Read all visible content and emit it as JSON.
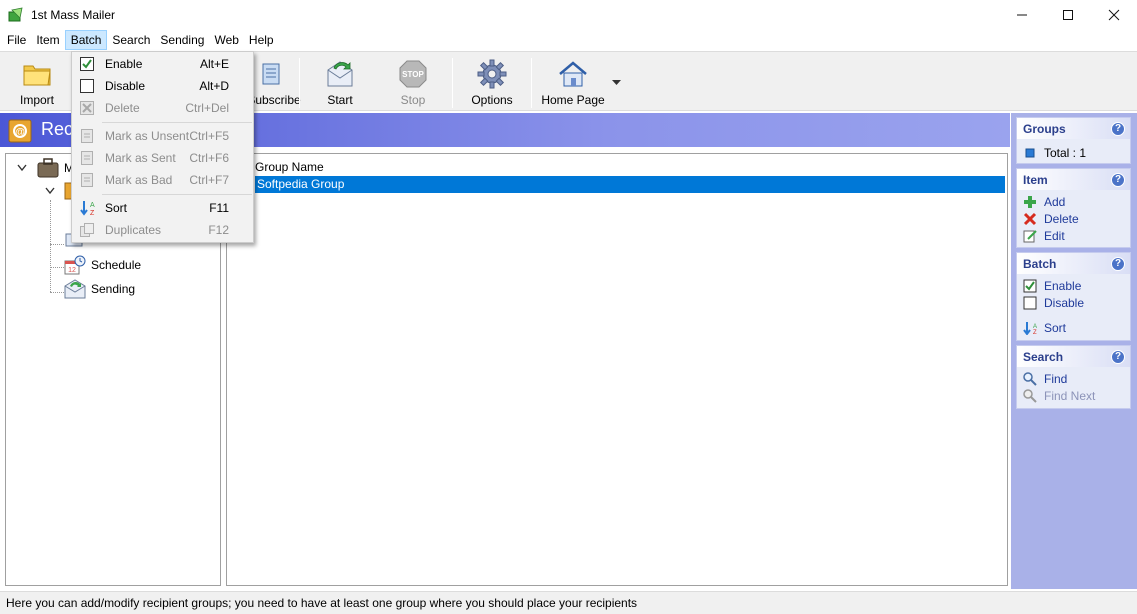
{
  "window": {
    "title": "1st Mass Mailer",
    "minimize_icon": "minimize-icon",
    "maximize_icon": "maximize-icon",
    "close_icon": "close-icon"
  },
  "menubar": {
    "items": [
      {
        "label": "File"
      },
      {
        "label": "Item"
      },
      {
        "label": "Batch",
        "active": true
      },
      {
        "label": "Search"
      },
      {
        "label": "Sending"
      },
      {
        "label": "Web"
      },
      {
        "label": "Help"
      }
    ]
  },
  "toolbar": {
    "import_label": "Import",
    "subscribe_label": "Subscribe",
    "start_label": "Start",
    "stop_label": "Stop",
    "stop_icon_text": "STOP",
    "options_label": "Options",
    "homepage_label": "Home Page"
  },
  "batch_menu": {
    "items": [
      {
        "label": "Enable",
        "shortcut": "Alt+E",
        "enabled": true,
        "checked": true
      },
      {
        "label": "Disable",
        "shortcut": "Alt+D",
        "enabled": true
      },
      {
        "label": "Delete",
        "shortcut": "Ctrl+Del",
        "enabled": false
      },
      {
        "label": "Mark as Unsent",
        "shortcut": "Ctrl+F5",
        "enabled": false
      },
      {
        "label": "Mark as Sent",
        "shortcut": "Ctrl+F6",
        "enabled": false
      },
      {
        "label": "Mark as Bad",
        "shortcut": "Ctrl+F7",
        "enabled": false
      },
      {
        "label": "Sort",
        "shortcut": "F11",
        "enabled": true
      },
      {
        "label": "Duplicates",
        "shortcut": "F12",
        "enabled": false
      }
    ]
  },
  "section": {
    "title": "Rec"
  },
  "tree": {
    "root_label": "M",
    "schedule_label": "Schedule",
    "sending_label": "Sending"
  },
  "grid": {
    "column_header": "Group Name",
    "rows": [
      {
        "name": "Softpedia Group",
        "selected": true
      }
    ]
  },
  "side": {
    "groups": {
      "title": "Groups",
      "total": "Total : 1"
    },
    "item": {
      "title": "Item",
      "add": "Add",
      "delete": "Delete",
      "edit": "Edit"
    },
    "batch": {
      "title": "Batch",
      "enable": "Enable",
      "disable": "Disable",
      "sort": "Sort"
    },
    "search": {
      "title": "Search",
      "find": "Find",
      "find_next": "Find Next"
    },
    "help_glyph": "?"
  },
  "statusbar": {
    "text": "Here you can add/modify recipient groups; you need to have at least one group where you should place your recipients"
  },
  "colors": {
    "accent": "#0078d7",
    "section_bar": "#4b57d6",
    "side_panel": "#a9b1e8",
    "link_blue": "#1f3a9a"
  }
}
